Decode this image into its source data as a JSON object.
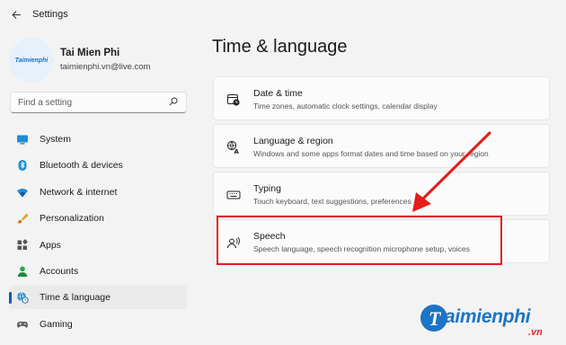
{
  "window": {
    "title": "Settings"
  },
  "profile": {
    "name": "Tai Mien Phi",
    "email": "taimienphi.vn@live.com",
    "avatar_text": "Taimienphi"
  },
  "search": {
    "placeholder": "Find a setting"
  },
  "nav": {
    "items": [
      {
        "label": "System",
        "icon": "monitor-icon",
        "active": false
      },
      {
        "label": "Bluetooth & devices",
        "icon": "bluetooth-icon",
        "active": false
      },
      {
        "label": "Network & internet",
        "icon": "wifi-icon",
        "active": false
      },
      {
        "label": "Personalization",
        "icon": "brush-icon",
        "active": false
      },
      {
        "label": "Apps",
        "icon": "apps-grid-icon",
        "active": false
      },
      {
        "label": "Accounts",
        "icon": "person-icon",
        "active": false
      },
      {
        "label": "Time & language",
        "icon": "globe-clock-icon",
        "active": true
      },
      {
        "label": "Gaming",
        "icon": "gamepad-icon",
        "active": false
      }
    ]
  },
  "page": {
    "title": "Time & language"
  },
  "cards": [
    {
      "title": "Date & time",
      "description": "Time zones, automatic clock settings, calendar display",
      "icon": "calendar-clock-icon"
    },
    {
      "title": "Language & region",
      "description": "Windows and some apps format dates and time based on your region",
      "icon": "language-icon"
    },
    {
      "title": "Typing",
      "description": "Touch keyboard, text suggestions, preferences",
      "icon": "keyboard-icon"
    },
    {
      "title": "Speech",
      "description": "Speech language, speech recognition microphone setup, voices",
      "icon": "speech-icon"
    }
  ],
  "annotation": {
    "highlight_color": "#e41c1c"
  },
  "watermark": {
    "text": "aimienphi",
    "logo_letter": "T",
    "suffix": ".vn"
  },
  "colors": {
    "accent": "#005fb8",
    "background": "#f3f3f3",
    "card": "#fbfbfb"
  }
}
